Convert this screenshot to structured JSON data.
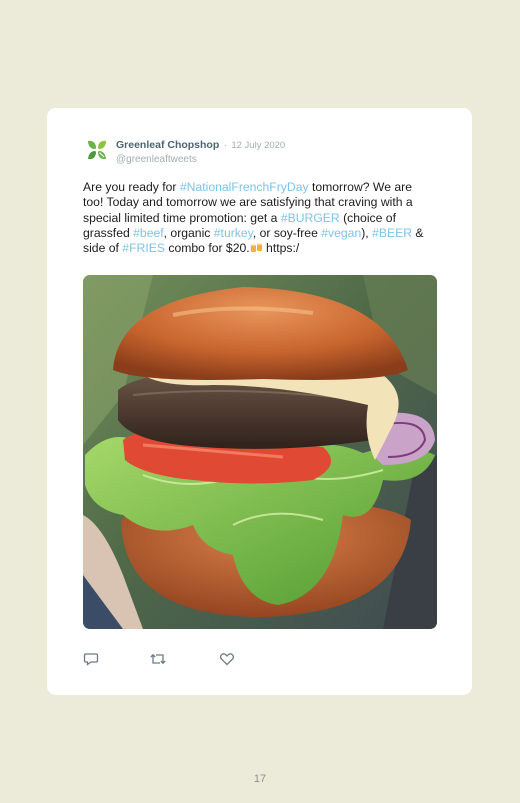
{
  "tweet": {
    "author_name": "Greenleaf Chopshop",
    "separator": "·",
    "date": "12 July 2020",
    "handle": "@greenleaftweets",
    "text_parts": [
      "Are you ready for ",
      "#NationalFrenchFryDay",
      " tomorrow? We are too! Today and tomorrow we are satisfying that craving with a special limited time promotion: get a ",
      "#BURGER",
      " (choice of grassfed ",
      "#beef",
      ", organic ",
      "#turkey",
      ", or soy-free ",
      "#vegan",
      "), ",
      "#BEER",
      " & side of ",
      "#FRIES",
      " combo for $20.",
      " https:/"
    ]
  },
  "icons": {
    "logo": "greenleaf-logo",
    "emoji": "beer-mugs-emoji",
    "reply": "reply-icon",
    "retweet": "retweet-icon",
    "like": "heart-icon"
  },
  "colors": {
    "background": "#ecebd9",
    "card": "#ffffff",
    "hashtag": "#7ec3e8",
    "author": "#4d6474",
    "muted": "#a3adb3",
    "logo_green": "#6bb24a"
  },
  "page": {
    "number": "17"
  }
}
